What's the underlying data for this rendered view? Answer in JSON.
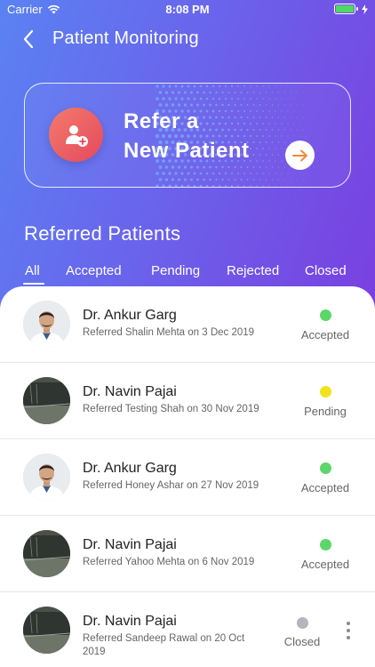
{
  "status_bar": {
    "carrier": "Carrier",
    "time": "8:08 PM"
  },
  "header": {
    "title": "Patient Monitoring"
  },
  "refer_card": {
    "line1": "Refer a",
    "line2": "New Patient"
  },
  "section": {
    "title": "Referred Patients"
  },
  "tabs": [
    {
      "label": "All",
      "active": true
    },
    {
      "label": "Accepted",
      "active": false
    },
    {
      "label": "Pending",
      "active": false
    },
    {
      "label": "Rejected",
      "active": false
    },
    {
      "label": "Closed",
      "active": false
    }
  ],
  "referrals": [
    {
      "doctor": "Dr. Ankur Garg",
      "description": "Referred Shalin Mehta on 3 Dec 2019",
      "status": "Accepted",
      "status_color": "#5cd66a",
      "photo": "doctor-portrait"
    },
    {
      "doctor": "Dr. Navin Pajai",
      "description": "Referred Testing Shah on 30 Nov 2019",
      "status": "Pending",
      "status_color": "#f0e31c",
      "photo": "screen-photo"
    },
    {
      "doctor": "Dr. Ankur Garg",
      "description": "Referred Honey Ashar on 27 Nov 2019",
      "status": "Accepted",
      "status_color": "#5cd66a",
      "photo": "doctor-portrait"
    },
    {
      "doctor": "Dr. Navin Pajai",
      "description": "Referred Yahoo Mehta on 6 Nov 2019",
      "status": "Accepted",
      "status_color": "#5cd66a",
      "photo": "screen-photo"
    },
    {
      "doctor": "Dr. Navin Pajai",
      "description": "Referred Sandeep Rawal on 20 Oct 2019",
      "status": "Closed",
      "status_color": "#b9b3bd",
      "photo": "screen-photo"
    }
  ],
  "colors": {
    "gradient_start": "#5a82f2",
    "gradient_end": "#7a3fe0",
    "accent_orange": "#f08a3a",
    "refer_icon": "#e4495f"
  },
  "icons": {
    "back": "chevron-left-icon",
    "wifi": "wifi-icon",
    "battery": "battery-icon",
    "refer": "add-user-icon",
    "arrow": "arrow-right-icon",
    "more": "more-vertical-icon"
  }
}
